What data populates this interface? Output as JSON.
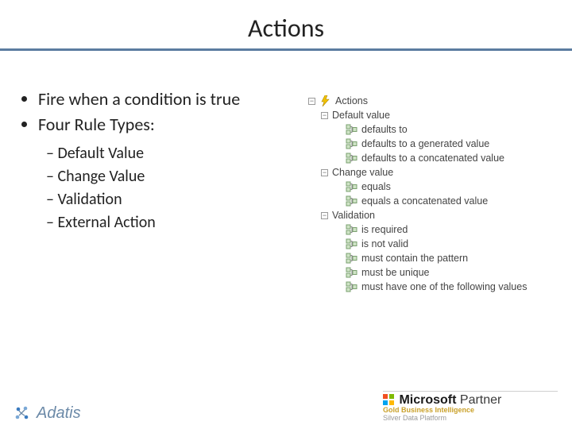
{
  "title": "Actions",
  "bullets": [
    "Fire when a condition is true",
    "Four Rule Types:"
  ],
  "sub_items": [
    "Default Value",
    "Change Value",
    "Validation",
    "External Action"
  ],
  "tree": {
    "root": "Actions",
    "groups": [
      {
        "label": "Default value",
        "children": [
          "defaults to",
          "defaults to a generated value",
          "defaults to a concatenated value"
        ]
      },
      {
        "label": "Change value",
        "children": [
          "equals",
          "equals a concatenated value"
        ]
      },
      {
        "label": "Validation",
        "children": [
          "is required",
          "is not valid",
          "must contain the pattern",
          "must be unique",
          "must have one of the following values"
        ]
      }
    ]
  },
  "footer": {
    "adatis": "Adatis",
    "ms_prefix": "Microsoft",
    "ms_suffix": "Partner",
    "gold": "Gold Business Intelligence",
    "silver": "Silver Data Platform"
  }
}
